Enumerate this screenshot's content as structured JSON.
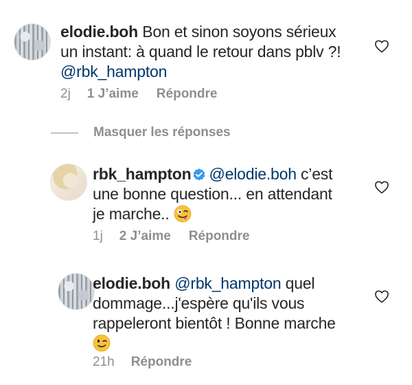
{
  "comments": [
    {
      "username": "elodie.boh",
      "text": " Bon et sinon soyons sérieux",
      "text2": "un instant: à quand le retour dans pblv ?!",
      "mention": "@rbk_hampton",
      "time": "2j",
      "likes": "1 J’aime",
      "reply": "Répondre"
    },
    {
      "username": "rbk_hampton",
      "mention": "@elodie.boh",
      "text": " c’est",
      "text2": "une bonne question... en attendant",
      "text3": "je marche..",
      "time": "1j",
      "likes": "2 J’aime",
      "reply": "Répondre"
    },
    {
      "username": "elodie.boh",
      "mention": "@rbk_hampton",
      "text": " quel",
      "text2": "dommage...j'espère qu'ils vous",
      "text3": "rappeleront bientôt ! Bonne marche",
      "time": "21h",
      "reply": "Répondre"
    }
  ],
  "hide_replies": "Masquer les réponses",
  "icons": {
    "like": "heart-icon",
    "verified": "verified-badge-icon",
    "emoji_tongue": "winking-face-with-tongue-emoji",
    "emoji_wink": "winking-face-emoji"
  },
  "colors": {
    "text": "#262626",
    "secondary": "#8e8e8e",
    "mention": "#00376b",
    "verified": "#3897f0"
  }
}
